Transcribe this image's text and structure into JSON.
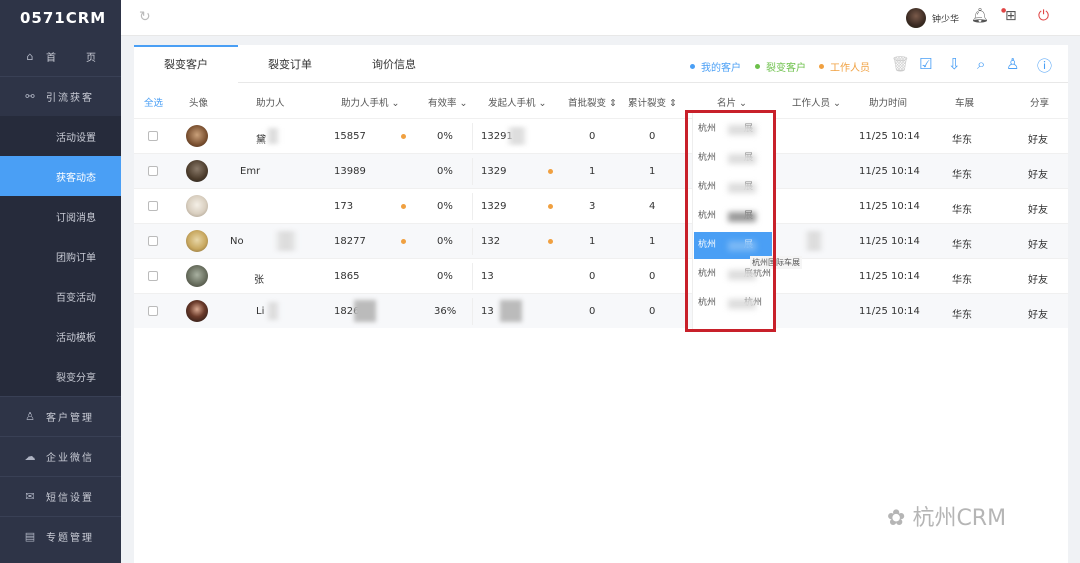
{
  "app": {
    "logo": "0571CRM"
  },
  "sidebar": {
    "home": {
      "label": "首",
      "label2": "页"
    },
    "group1": {
      "label": "引流获客"
    },
    "subitems": [
      {
        "label": "活动设置"
      },
      {
        "label": "获客动态"
      },
      {
        "label": "订阅消息"
      },
      {
        "label": "团购订单"
      },
      {
        "label": "百变活动"
      },
      {
        "label": "活动模板"
      },
      {
        "label": "裂变分享"
      }
    ],
    "groups": [
      {
        "label": "客户管理"
      },
      {
        "label": "企业微信"
      },
      {
        "label": "短信设置"
      },
      {
        "label": "专题管理"
      }
    ]
  },
  "topbar": {
    "user_name": "钟少华"
  },
  "tabs": [
    {
      "label": "裂变客户"
    },
    {
      "label": "裂变订单"
    },
    {
      "label": "询价信息"
    }
  ],
  "legend": [
    {
      "label": "我的客户",
      "color": "#4a9ff5"
    },
    {
      "label": "裂变客户",
      "color": "#6cc04a"
    },
    {
      "label": "工作人员",
      "color": "#f0a040"
    }
  ],
  "table": {
    "headers": {
      "select_all": "全选",
      "avatar": "头像",
      "helper": "助力人",
      "helper_phone": "助力人手机",
      "efficiency": "有效率",
      "initiator_phone": "发起人手机",
      "first_fission": "首批裂变",
      "total_fission": "累计裂变",
      "card": "名片",
      "staff": "工作人员",
      "help_time": "助力时间",
      "exhibition": "车展",
      "share": "分享"
    },
    "rows": [
      {
        "helper": "黛",
        "phone": "15857",
        "rate": "0%",
        "iphone": "13291",
        "first": "0",
        "total": "0",
        "time": "11/25 10:14",
        "show": "华东",
        "share": "好友"
      },
      {
        "helper": "Emr",
        "phone": "13989",
        "rate": "0%",
        "iphone": "1329",
        "first": "1",
        "total": "1",
        "time": "11/25 10:14",
        "show": "华东",
        "share": "好友"
      },
      {
        "helper": "",
        "phone": "173",
        "rate": "0%",
        "iphone": "1329",
        "first": "3",
        "total": "4",
        "time": "11/25 10:14",
        "show": "华东",
        "share": "好友"
      },
      {
        "helper": "No",
        "phone": "18277",
        "rate": "0%",
        "iphone": "132",
        "first": "1",
        "total": "1",
        "time": "11/25 10:14",
        "show": "华东",
        "share": "好友"
      },
      {
        "helper": "张",
        "phone": "1865",
        "rate": "0%",
        "iphone": "13",
        "first": "0",
        "total": "0",
        "time": "11/25 10:14",
        "show": "华东",
        "share": "好友"
      },
      {
        "helper": "Li",
        "phone": "1826",
        "rate": "36%",
        "iphone": "13",
        "first": "0",
        "total": "0",
        "time": "11/25 10:14",
        "show": "华东",
        "share": "好友"
      }
    ]
  },
  "dropdown": {
    "items": [
      "杭州",
      "杭州",
      "杭州",
      "杭州",
      "杭州",
      "杭州",
      "杭州"
    ],
    "suffixes": [
      "展",
      "展",
      "展",
      "展",
      "展",
      "展杭州",
      "杭州"
    ],
    "selected_index": 3,
    "tooltip": "杭州国际车展"
  },
  "watermark": "杭州CRM"
}
